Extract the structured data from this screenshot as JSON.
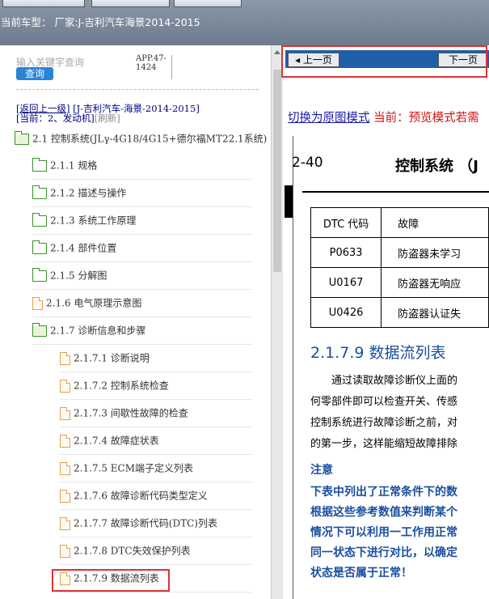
{
  "vehicle_label": "当前车型：  厂家:J-吉利汽车海景2014-2015",
  "search": {
    "placeholder": "输入关键字查询",
    "button": "查询"
  },
  "app_code": [
    "APP.47-",
    "1424"
  ],
  "breadcrumb": {
    "back": "[返回上一级]",
    "path": "[J-吉利汽车-海景-2014-2015]",
    "current": "[当前：2、发动机]",
    "refresh": "[刷新]"
  },
  "tree": [
    {
      "label": "2.1 控制系统(JLγ-4G18/4G15+德尔福MT22.1系统)",
      "type": "folder-open"
    },
    {
      "label": "2.1.1 规格",
      "type": "folder"
    },
    {
      "label": "2.1.2 描述与操作",
      "type": "folder"
    },
    {
      "label": "2.1.3 系统工作原理",
      "type": "folder"
    },
    {
      "label": "2.1.4 部件位置",
      "type": "folder"
    },
    {
      "label": "2.1.5 分解图",
      "type": "folder"
    },
    {
      "label": "2.1.6 电气原理示意图",
      "type": "file"
    },
    {
      "label": "2.1.7 诊断信息和步骤",
      "type": "folder-open"
    },
    {
      "label": "2.1.7.1 诊断说明",
      "type": "file"
    },
    {
      "label": "2.1.7.2 控制系统检查",
      "type": "file"
    },
    {
      "label": "2.1.7.3 间歇性故障的检查",
      "type": "file"
    },
    {
      "label": "2.1.7.4 故障症状表",
      "type": "file"
    },
    {
      "label": "2.1.7.5 ECM端子定义列表",
      "type": "file"
    },
    {
      "label": "2.1.7.6 故障诊断代码类型定义",
      "type": "file"
    },
    {
      "label": "2.1.7.7 故障诊断代码(DTC)列表",
      "type": "file"
    },
    {
      "label": "2.1.7.8 DTC失效保护列表",
      "type": "file"
    },
    {
      "label": "2.1.7.9 数据流列表",
      "type": "file"
    }
  ],
  "nav": {
    "prev": "上一页",
    "next": "下一页"
  },
  "mode": {
    "link": "切换为原图模式",
    "current": "当前：预览模式",
    "tail": "若需"
  },
  "doc": {
    "page_number": "2-40",
    "page_title": "控制系统 （J",
    "table_header": [
      "DTC 代码",
      "故障"
    ],
    "table_rows": [
      [
        "P0633",
        "防盗器未学习"
      ],
      [
        "U0167",
        "防盗器无响应"
      ],
      [
        "U0426",
        "防盗器认证失"
      ]
    ],
    "section_title": "2.1.7.9  数据流列表",
    "paragraph": [
      "　　通过读取故障诊断仪上面的",
      "何零部件即可以检查开关、传感",
      "控制系统进行故障诊断之前，对",
      "的第一步，这样能缩短故障排除"
    ],
    "note_title": "注意",
    "note_lines": [
      "下表中列出了正常条件下的数",
      "根据这些参考数值来判断某个",
      "情况下可以利用一工作用正常",
      "同一状态下进行对比，以确定",
      "状态是否属于正常！"
    ]
  }
}
